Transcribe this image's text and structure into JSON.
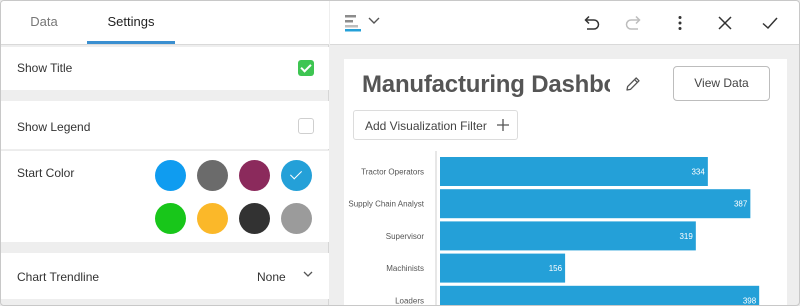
{
  "tabs": [
    {
      "label": "Data"
    },
    {
      "label": "Settings"
    }
  ],
  "settings": {
    "show_title": {
      "label": "Show Title",
      "checked": true
    },
    "show_legend": {
      "label": "Show Legend",
      "checked": false
    },
    "start_color": {
      "label": "Start Color",
      "colors": [
        "#0f9cf0",
        "#6b6b6b",
        "#8b2a5c",
        "#24a0d8",
        "#18c61a",
        "#fbb829",
        "#323232",
        "#9b9b9b"
      ],
      "selected_index": 3
    },
    "chart_trendline": {
      "label": "Chart Trendline",
      "value": "None"
    }
  },
  "toolbar": {
    "icons": [
      "chart-type-icon",
      "chevron-down-icon",
      "undo-icon",
      "redo-icon",
      "more-vertical-icon",
      "close-icon",
      "check-icon"
    ]
  },
  "visualization": {
    "title": "Manufacturing Dashboard",
    "view_data_label": "View Data",
    "filter_label": "Add Visualization Filter"
  },
  "chart_data": {
    "type": "bar",
    "orientation": "horizontal",
    "categories": [
      "Tractor Operators",
      "Supply Chain Analyst",
      "Supervisor",
      "Machinists",
      "Loaders"
    ],
    "values": [
      334,
      387,
      319,
      156,
      398
    ],
    "bar_color": "#24a0d8",
    "grid": false
  }
}
